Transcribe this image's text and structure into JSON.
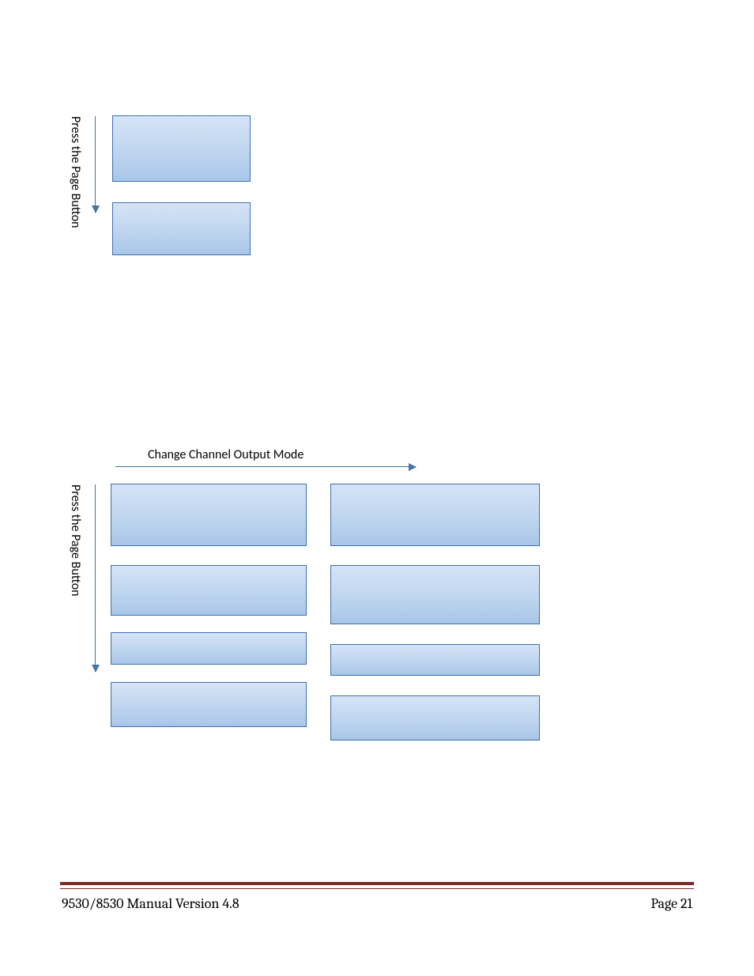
{
  "section1": {
    "vertical_label": "Press the Page Button"
  },
  "section2": {
    "horizontal_label": "Change Channel Output Mode",
    "vertical_label": "Press the Page Button"
  },
  "footer": {
    "left": "9530/8530 Manual Version 4.8",
    "right": "Page 21"
  }
}
